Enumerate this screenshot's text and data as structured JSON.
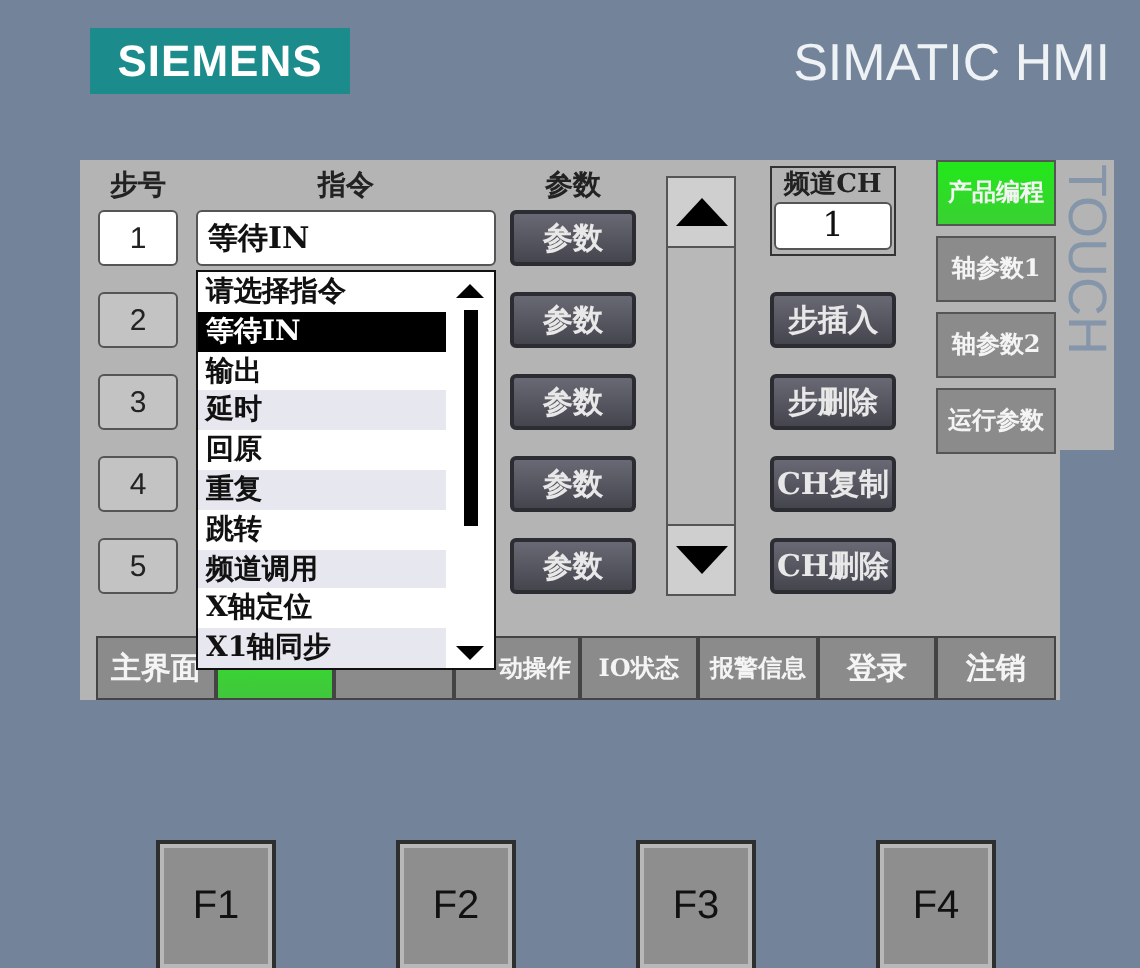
{
  "brand": {
    "logo": "SIEMENS",
    "product": "SIMATIC HMI",
    "side_label": "TOUCH"
  },
  "program": {
    "columns": [
      "步号",
      "指令",
      "参数"
    ],
    "steps": [
      {
        "number": "1",
        "selected": true
      },
      {
        "number": "2",
        "selected": false
      },
      {
        "number": "3",
        "selected": false
      },
      {
        "number": "4",
        "selected": false
      },
      {
        "number": "5",
        "selected": false
      }
    ],
    "instruction": "等待IN",
    "param_buttons": [
      "参数",
      "参数",
      "参数",
      "参数",
      "参数"
    ]
  },
  "dropdown": {
    "items": [
      {
        "label": "请选择指令",
        "selected": false
      },
      {
        "label": "等待IN",
        "selected": true
      },
      {
        "label": "输出",
        "selected": false
      },
      {
        "label": "延时",
        "selected": false
      },
      {
        "label": "回原",
        "selected": false
      },
      {
        "label": "重复",
        "selected": false
      },
      {
        "label": "跳转",
        "selected": false
      },
      {
        "label": "频道调用",
        "selected": false
      },
      {
        "label": "X轴定位",
        "selected": false
      },
      {
        "label": "X1轴同步",
        "selected": false
      }
    ]
  },
  "channel": {
    "label": "频道CH",
    "value": "1"
  },
  "actions": [
    "步插入",
    "步删除",
    "CH复制",
    "CH删除"
  ],
  "side_menu": [
    {
      "label": "产品编程",
      "selected": true
    },
    {
      "label": "轴参数1",
      "selected": false
    },
    {
      "label": "轴参数2",
      "selected": false
    },
    {
      "label": "运行参数",
      "selected": false
    }
  ],
  "tabs": [
    {
      "label": "主界面",
      "selected": false
    },
    {
      "selected": true
    },
    {
      "selected": false
    },
    {
      "label": "动操作",
      "selected": false
    },
    {
      "label": "IO状态",
      "selected": false
    },
    {
      "label": "报警信息",
      "selected": false
    },
    {
      "label": "登录",
      "selected": false
    },
    {
      "label": "注销",
      "selected": false
    }
  ],
  "function_keys": [
    "F1",
    "F2",
    "F3",
    "F4"
  ]
}
